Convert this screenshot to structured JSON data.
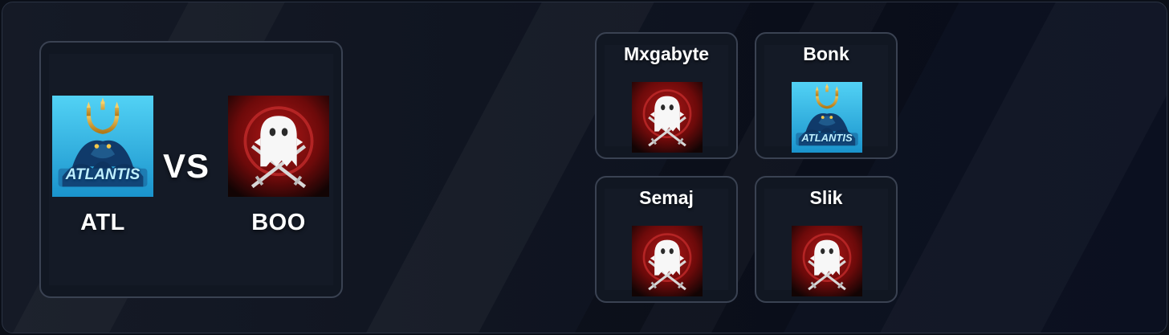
{
  "match": {
    "home_team": {
      "name": "ATL",
      "logo_text": "ATLANTIS",
      "logo": "atlantis-trident-logo"
    },
    "vs_label": "VS",
    "away_team": {
      "name": "BOO",
      "logo": "ghost-crossed-swords-logo"
    }
  },
  "players": [
    {
      "name": "Mxgabyte",
      "logo": "ghost-crossed-swords-logo"
    },
    {
      "name": "Bonk",
      "logo": "atlantis-trident-logo",
      "logo_text": "ATLANTIS"
    },
    {
      "name": "Semaj",
      "logo": "ghost-crossed-swords-logo"
    },
    {
      "name": "Slik",
      "logo": "ghost-crossed-swords-logo"
    }
  ],
  "colors": {
    "background": "#0b0f18",
    "card_border": "#3a4252",
    "atlantis_blue": "#29b8e8",
    "boo_red": "#8a0c0c",
    "text": "#ffffff"
  }
}
